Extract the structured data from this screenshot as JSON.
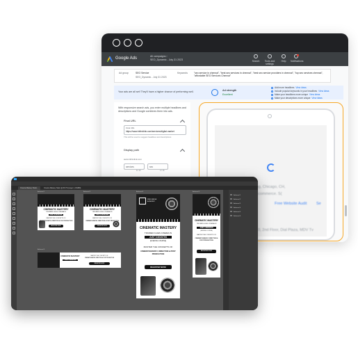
{
  "ads": {
    "product": "Google Ads",
    "campaign_line1": "All campaigns  ›",
    "campaign_line2": "SEO_Dynamic - July 31 2023",
    "tools": [
      {
        "label": "Search"
      },
      {
        "label": "Tools and settings"
      },
      {
        "label": "Help"
      },
      {
        "label": "Notifications"
      }
    ],
    "adgroup": {
      "label": "Ad group",
      "name": "SEO Service",
      "date": "SEO_Dynamic - July 31 2023",
      "keywords_label": "Keywords",
      "keywords": "\"seo service in chennai\", \"best seo services in chennai\", \"best seo service providers in chennai\", \"top seo services chennai\", \"affordable SEO Services Chennai\""
    },
    "strength": {
      "message": "Your ads are all set! They'll have a higher chance of performing well.",
      "title": "Ad strength",
      "value": "Excellent",
      "tips": [
        {
          "text": "Add more headlines",
          "action": "View ideas"
        },
        {
          "text": "Include popular keywords in your headlines",
          "action": "View ideas"
        },
        {
          "text": "Make your headlines more unique",
          "action": "View ideas"
        },
        {
          "text": "Make your descriptions more unique",
          "action": "View ideas"
        }
      ]
    },
    "form": {
      "intro": "With responsive search ads, you enter multiple headlines and descriptions and Google combines them into ads.",
      "final_url_label": "Final URL",
      "final_url_field_label": "Final URL",
      "final_url_value": "https://www.infinixlink.com/services/digital-market",
      "final_url_hint": "This will be used to suggest headlines and descriptions",
      "display_path_label": "Display path",
      "display_domain": "www.infinixlink.com",
      "path1": "services",
      "path2": "seo",
      "path1_count": "8 / 15",
      "path2_count": "3 / 15"
    },
    "preview": {
      "line1": "ion Service Catalog, Chicago, CH,",
      "line2": "bsite Migration. E-commerce. S(",
      "btn1": "ltation",
      "btn2": "Free Website Audit",
      "btn3": "Se",
      "footer": "n: 10, 2nd Floor, Dial Plaza, MDV Tv"
    }
  },
  "ps": {
    "tabs": [
      "Cinema Mastery Static...",
      "Cinema Mastery Static @ 66.7% (Layer 1, RGB/8)"
    ],
    "layers": [
      "Artboard 1",
      "Artboard 2",
      "Artboard 3",
      "Artboard 4",
      "Artboard 5",
      "Artboard 6"
    ],
    "artboards": {
      "a1_label": "Artboard 1",
      "a2_label": "Artboard 2",
      "a3_label": "Artboard 3",
      "a4_label": "Artboard 4",
      "a5_label": "Artboard 5",
      "headline": "CINEMATIC MASTERY",
      "subline": "TIRUMEN GUES CINEMA IN",
      "badge": "JUST 6 MONTHS",
      "mode": "(EVENING COURSE)",
      "master": "MASTER THE CONCEPTS OF",
      "skills": "CINEMATOGRAPHY, DIRECTION & POST PRODUCTION",
      "cta": "REGISTER NOW!",
      "logo_text": "WEIS MEDIA ACADEMY"
    }
  },
  "colors": {
    "ads_header": "#3c4043",
    "ads_accent": "#1a73e8",
    "preview_border": "#f6a623",
    "ps_workspace": "#535353"
  }
}
